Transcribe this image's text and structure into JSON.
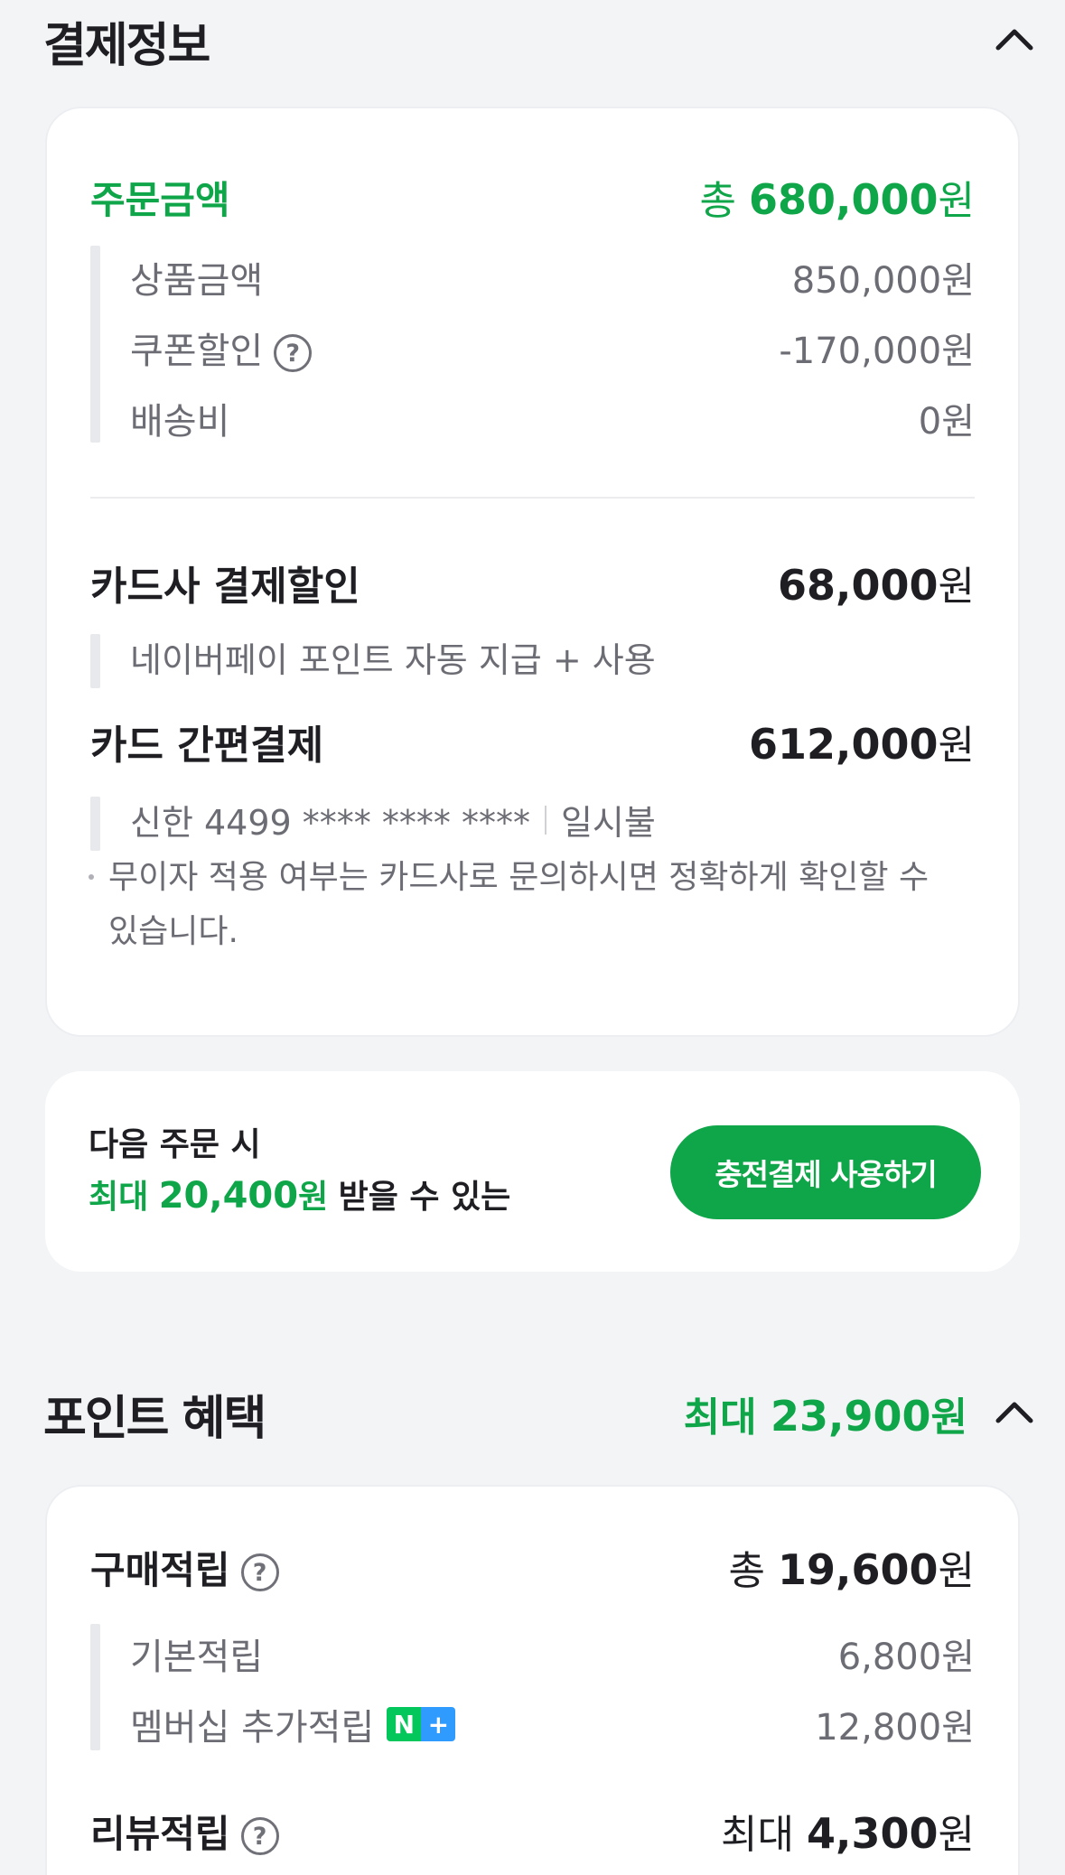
{
  "payment_section": {
    "title": "결제정보",
    "order": {
      "label": "주문금액",
      "total_prefix": "총",
      "total_value": "680,000",
      "unit": "원"
    },
    "breakdown": [
      {
        "label": "상품금액",
        "value": "850,000원"
      },
      {
        "label": "쿠폰할인",
        "value": "-170,000원",
        "has_help": true
      },
      {
        "label": "배송비",
        "value": "0원"
      }
    ],
    "card_discount": {
      "label": "카드사 결제할인",
      "value": "68,000",
      "unit": "원",
      "detail": "네이버페이 포인트 자동 지급 + 사용"
    },
    "card_pay": {
      "label": "카드 간편결제",
      "value": "612,000",
      "unit": "원",
      "card_info": "신한 4499 **** **** ****",
      "installment": "일시불"
    },
    "notice_line1": "무이자 적용 여부는 카드사로 문의하시면 정확하게 확인할 수",
    "notice_line2": "있습니다."
  },
  "charge_promo": {
    "line1": "다음 주문 시",
    "prefix": "최대",
    "amount": "20,400",
    "unit": "원",
    "suffix": "받을 수 있는",
    "button_label": "충전결제 사용하기"
  },
  "points_section": {
    "title": "포인트 혜택",
    "max_prefix": "최대",
    "max_value": "23,900",
    "unit": "원",
    "purchase": {
      "label": "구매적립",
      "total_prefix": "총",
      "total_value": "19,600",
      "unit": "원"
    },
    "purchase_breakdown": [
      {
        "label": "기본적립",
        "value": "6,800원"
      },
      {
        "label": "멤버십 추가적립",
        "value": "12,800원",
        "badge": [
          "N",
          "+"
        ]
      }
    ],
    "review": {
      "label": "리뷰적립",
      "prefix": "최대",
      "value": "4,300",
      "unit": "원"
    }
  },
  "colors": {
    "accent": "#0fa549",
    "badge_n": "#03c75a",
    "badge_plus": "#2f9bff"
  },
  "icons": [
    "chevron-up-icon",
    "help-circle-icon",
    "n-plus-badge-icon"
  ]
}
